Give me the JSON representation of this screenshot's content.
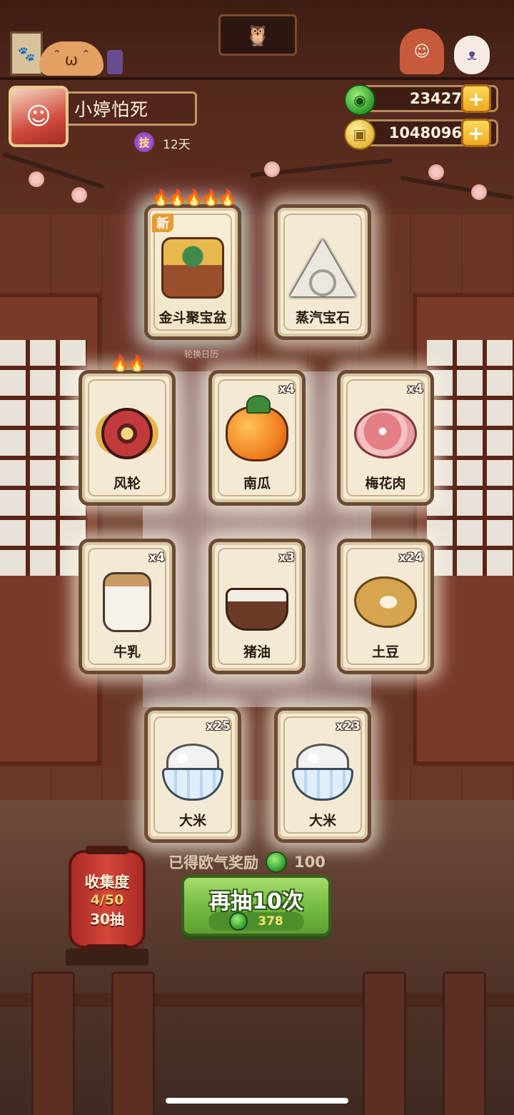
{
  "profile": {
    "name": "小婷怕死",
    "skill_badge": "技",
    "days": "12天"
  },
  "currency": {
    "jade": "23427",
    "coins": "1048096"
  },
  "top_sign_icon": "owl-portrait-icon",
  "featured_cards": [
    {
      "name": "金斗聚宝盆",
      "count": "",
      "tag": "新",
      "flames": "🔥🔥🔥🔥🔥",
      "icon": "treasure-bowl-icon"
    },
    {
      "name": "蒸汽宝石",
      "count": "",
      "tag": "",
      "flames": "",
      "icon": "steam-gem-icon"
    }
  ],
  "rotation_caption": "轮换日历",
  "cards_row1": [
    {
      "name": "风轮",
      "count": "",
      "flames": "🔥🔥",
      "icon": "wind-wheel-icon"
    },
    {
      "name": "南瓜",
      "count": "x4",
      "flames": "",
      "icon": "pumpkin-icon"
    },
    {
      "name": "梅花肉",
      "count": "x4",
      "flames": "",
      "icon": "pork-icon"
    }
  ],
  "cards_row2": [
    {
      "name": "牛乳",
      "count": "x4",
      "icon": "milk-jar-icon"
    },
    {
      "name": "猪油",
      "count": "x3",
      "icon": "lard-icon"
    },
    {
      "name": "土豆",
      "count": "x24",
      "icon": "potato-icon"
    }
  ],
  "cards_row3": [
    {
      "name": "大米",
      "count": "x25",
      "icon": "rice-bowl-icon"
    },
    {
      "name": "大米",
      "count": "x23",
      "icon": "rice-bowl-icon"
    }
  ],
  "luck_reward": {
    "label": "已得欧气奖励",
    "value": "100"
  },
  "draw_button": {
    "label": "再抽10次",
    "cost": "378"
  },
  "collection": {
    "title": "收集度",
    "progress": "4/50",
    "draws": "30抽"
  }
}
